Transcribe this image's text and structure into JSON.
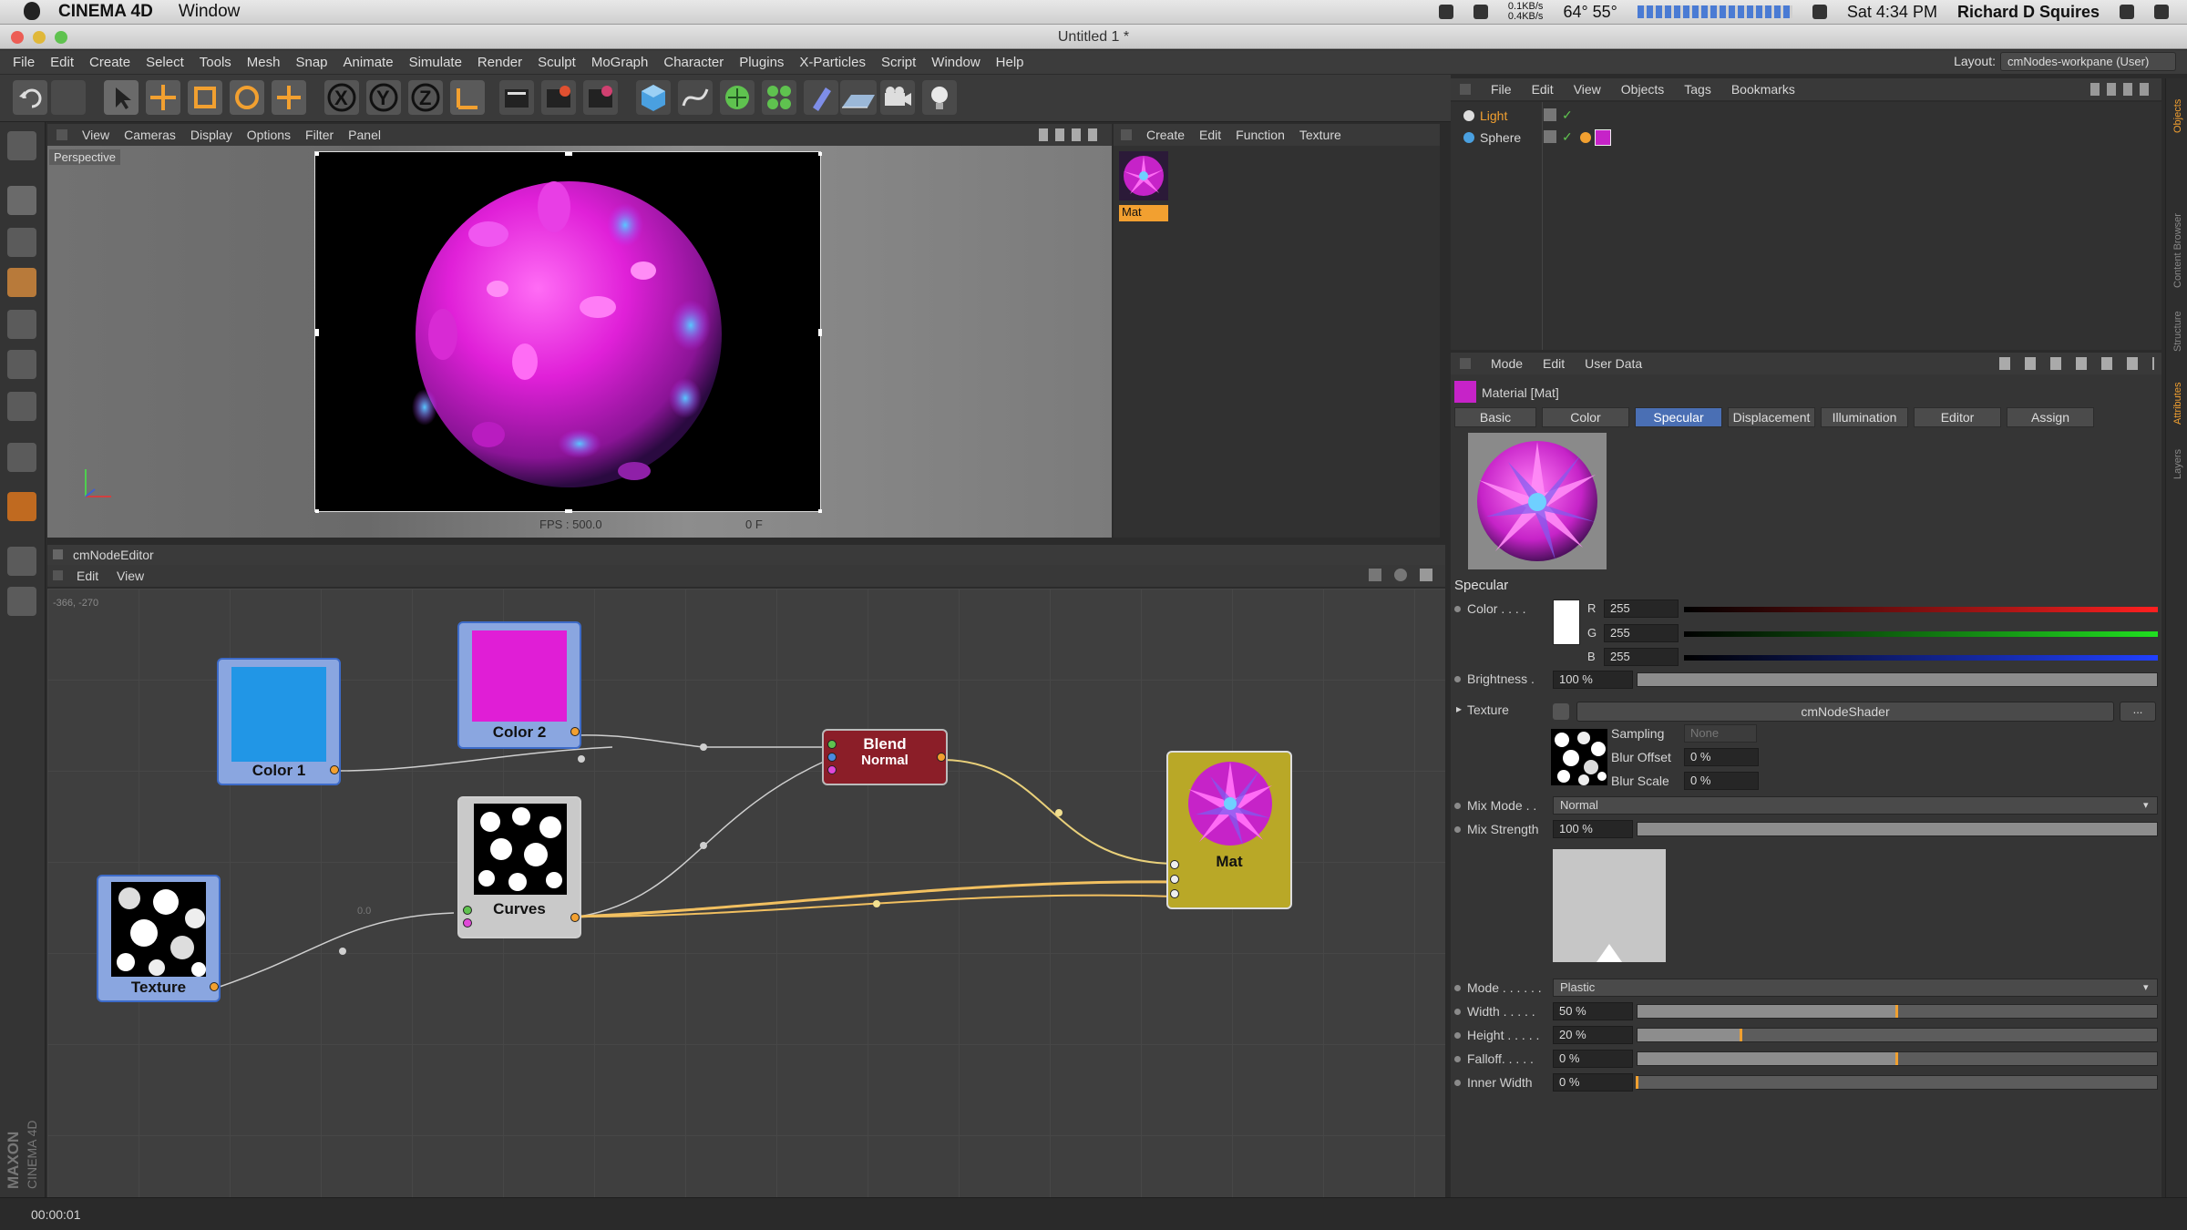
{
  "mac_menubar": {
    "app": "CINEMA 4D",
    "menu": "Window",
    "network": "0.1KB/s\n0.4KB/s",
    "temps": "64° 55°",
    "time": "Sat 4:34 PM",
    "user": "Richard D Squires"
  },
  "window": {
    "title": "Untitled 1 *"
  },
  "app_menu": [
    "File",
    "Edit",
    "Create",
    "Select",
    "Tools",
    "Mesh",
    "Snap",
    "Animate",
    "Simulate",
    "Render",
    "Sculpt",
    "MoGraph",
    "Character",
    "Plugins",
    "X-Particles",
    "Script",
    "Window",
    "Help"
  ],
  "layout": {
    "label": "Layout:",
    "value": "cmNodes-workpane (User)"
  },
  "toolbar_icons": [
    "undo-icon",
    "redo-icon",
    "select-arrow-icon",
    "move-icon",
    "scale-icon",
    "rotate-icon",
    "add-icon",
    "x-axis-icon",
    "y-axis-icon",
    "z-axis-icon",
    "coordinate-system-icon",
    "render-view-icon",
    "render-picture-viewer-icon",
    "render-settings-icon",
    "cube-primitive-icon",
    "spline-pen-icon",
    "subdivision-icon",
    "cloner-icon",
    "deformer-icon",
    "floor-icon",
    "camera-icon",
    "light-icon"
  ],
  "viewport": {
    "menu": [
      "View",
      "Cameras",
      "Display",
      "Options",
      "Filter",
      "Panel"
    ],
    "label": "Perspective",
    "fps": "FPS : 500.0",
    "frame": "0 F"
  },
  "material_manager": {
    "menu": [
      "Create",
      "Edit",
      "Function",
      "Texture"
    ],
    "material_name": "Mat"
  },
  "objects_manager": {
    "menu": [
      "File",
      "Edit",
      "View",
      "Objects",
      "Tags",
      "Bookmarks"
    ],
    "objects": [
      {
        "name": "Light"
      },
      {
        "name": "Sphere"
      }
    ]
  },
  "attributes": {
    "menu": [
      "Mode",
      "Edit",
      "User Data"
    ],
    "title": "Material [Mat]",
    "tabs": [
      "Basic",
      "Color",
      "Specular",
      "Displacement",
      "Illumination",
      "Editor",
      "Assign"
    ],
    "active_tab": "Specular",
    "section": "Specular",
    "color": {
      "label": "Color . . . .",
      "r_label": "R",
      "g_label": "G",
      "b_label": "B",
      "r": "255",
      "g": "255",
      "b": "255",
      "swatch": "#ffffff"
    },
    "brightness": {
      "label": "Brightness .",
      "value": "100 %",
      "level": 1.0
    },
    "texture": {
      "label": "Texture",
      "shader": "cmNodeShader",
      "more": "...",
      "sampling_label": "Sampling",
      "sampling": "None",
      "blur_offset_label": "Blur Offset",
      "blur_offset": "0 %",
      "blur_scale_label": "Blur Scale",
      "blur_scale": "0 %"
    },
    "mix_mode": {
      "label": "Mix Mode . .",
      "value": "Normal"
    },
    "mix_strength": {
      "label": "Mix Strength",
      "value": "100 %",
      "level": 1.0
    },
    "mode": {
      "label": "Mode . . . . . .",
      "value": "Plastic"
    },
    "width": {
      "label": "Width . . . . .",
      "value": "50 %",
      "level": 0.5
    },
    "height": {
      "label": "Height . . . . .",
      "value": "20 %",
      "level": 0.2
    },
    "falloff": {
      "label": "Falloff. . . . .",
      "value": "0 %",
      "level": 0.5
    },
    "inner_width": {
      "label": "Inner Width",
      "value": "0 %",
      "level": 0.0
    }
  },
  "side_tabs": [
    "Objects",
    "Content Browser",
    "Structure",
    "Attributes",
    "Layers"
  ],
  "node_editor": {
    "title": "cmNodeEditor",
    "menu": [
      "Edit",
      "View"
    ],
    "coords": "-366, -270",
    "value_label": "0.0",
    "nodes": {
      "color1": {
        "label": "Color 1",
        "color": "#2196e6",
        "border": "#3d6bc8"
      },
      "color2": {
        "label": "Color 2",
        "color": "#e01ed6",
        "border": "#3d6bc8"
      },
      "curves": {
        "label": "Curves",
        "border": "#cfcfcf"
      },
      "texture": {
        "label": "Texture",
        "border": "#3d6bc8"
      },
      "blend": {
        "label": "Blend",
        "sublabel": "Normal",
        "color": "#8b1e28"
      },
      "mat": {
        "label": "Mat",
        "color": "#b9a827"
      }
    }
  },
  "brand": {
    "name": "MAXON",
    "product": "CINEMA 4D"
  },
  "status": {
    "time": "00:00:01"
  }
}
